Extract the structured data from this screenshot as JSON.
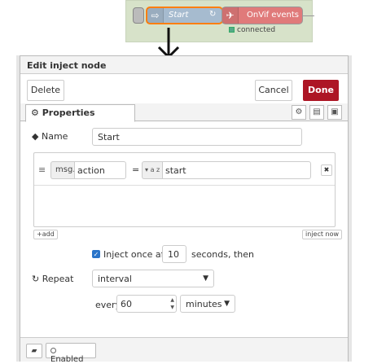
{
  "flow": {
    "inject_label": "Start",
    "repeat_icon": "↻",
    "onvif_label": "OnVif events",
    "status_text": "connected"
  },
  "tray": {
    "title": "Edit inject node",
    "delete_label": "Delete",
    "cancel_label": "Cancel",
    "done_label": "Done",
    "tab_properties": "Properties",
    "name_label": "Name",
    "name_value": "Start",
    "prop_prefix": "msg.",
    "prop_key": "action",
    "prop_equals": "=",
    "prop_type": "a z",
    "prop_value": "start",
    "add_label": "add",
    "inject_now_label": "inject now",
    "inject_once_prefix": "Inject once after",
    "inject_once_value": "10",
    "inject_once_suffix": "seconds, then",
    "repeat_label": "Repeat",
    "repeat_mode": "interval",
    "every_label": "every",
    "every_value": "60",
    "every_unit": "minutes",
    "enabled_label": "Enabled"
  },
  "colors": {
    "done_bg": "#ad1625",
    "inject_node": "#a6bbcf",
    "onvif_node": "#e07a7a",
    "flow_bg": "#d7e2c9",
    "selected_outline": "#ff7f0e"
  }
}
